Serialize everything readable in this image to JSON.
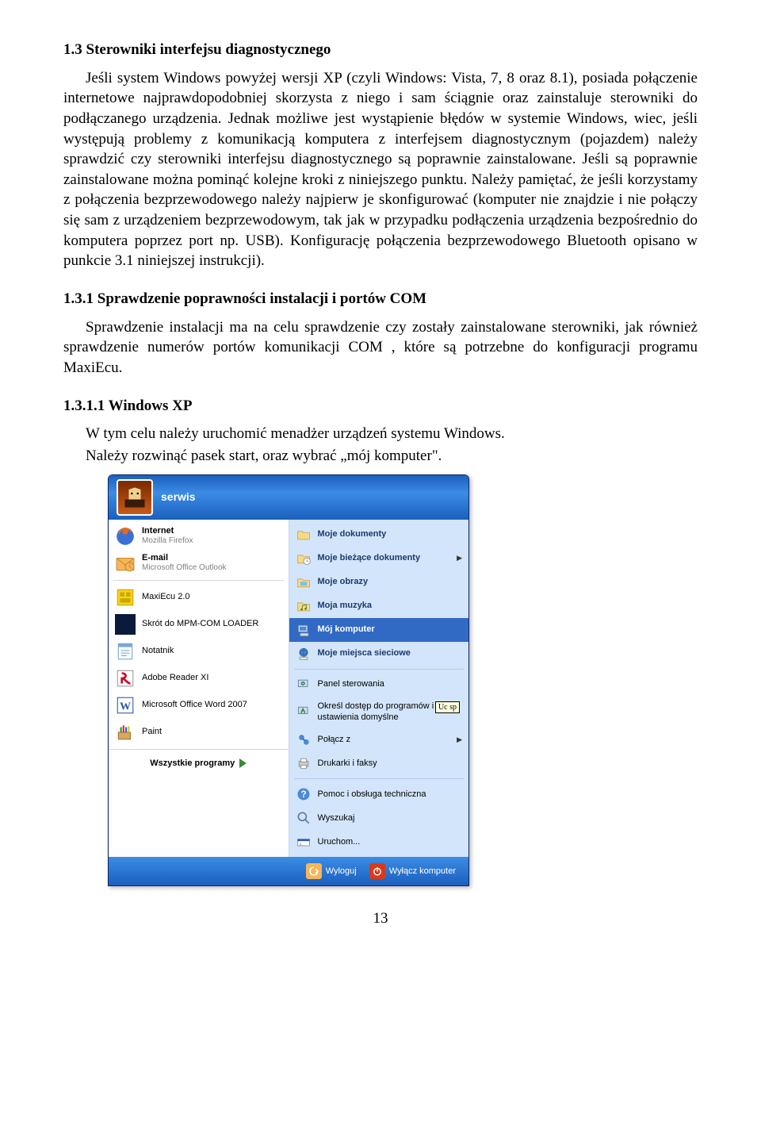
{
  "sec13": {
    "heading": "1.3 Sterowniki interfejsu diagnostycznego",
    "body": "Jeśli system Windows powyżej wersji XP (czyli Windows: Vista, 7, 8 oraz 8.1), posiada połączenie internetowe najprawdopodobniej skorzysta z niego i sam ściągnie oraz zainstaluje sterowniki do podłączanego urządzenia. Jednak możliwe jest wystąpienie błędów w systemie Windows, wiec, jeśli występują problemy z komunikacją komputera z interfejsem diagnostycznym (pojazdem) należy sprawdzić czy sterowniki interfejsu diagnostycznego są poprawnie zainstalowane. Jeśli są poprawnie zainstalowane można pominąć kolejne kroki z niniejszego punktu. Należy pamiętać, że jeśli korzystamy z połączenia bezprzewodowego należy najpierw je skonfigurować (komputer nie znajdzie i nie połączy się sam z urządzeniem bezprzewodowym, tak jak w przypadku podłączenia urządzenia bezpośrednio do komputera poprzez port np. USB). Konfigurację połączenia bezprzewodowego Bluetooth opisano w punkcie 3.1 niniejszej instrukcji)."
  },
  "sec131": {
    "heading": "1.3.1 Sprawdzenie poprawności instalacji i portów COM",
    "body": "Sprawdzenie instalacji ma na celu sprawdzenie czy zostały zainstalowane sterowniki, jak również sprawdzenie numerów portów komunikacji COM , które są potrzebne do konfiguracji programu MaxiEcu."
  },
  "sec1311": {
    "heading": "1.3.1.1 Windows XP",
    "line1": "W tym celu należy uruchomić menadżer urządzeń systemu Windows.",
    "line2": "Należy rozwinąć pasek start, oraz wybrać „mój komputer\"."
  },
  "start_menu": {
    "user": "serwis",
    "left": [
      {
        "label": "Internet",
        "sub": "Mozilla Firefox",
        "icon": "firefox"
      },
      {
        "label": "E-mail",
        "sub": "Microsoft Office Outlook",
        "icon": "outlook"
      },
      {
        "label": "MaxiEcu 2.0",
        "sub": "",
        "icon": "maxiecu"
      },
      {
        "label": "Skrót do MPM-COM LOADER",
        "sub": "",
        "icon": "moon"
      },
      {
        "label": "Notatnik",
        "sub": "",
        "icon": "notepad"
      },
      {
        "label": "Adobe Reader XI",
        "sub": "",
        "icon": "adobe"
      },
      {
        "label": "Microsoft Office Word 2007",
        "sub": "",
        "icon": "word"
      },
      {
        "label": "Paint",
        "sub": "",
        "icon": "paint"
      }
    ],
    "all_programs": "Wszystkie programy",
    "right": [
      {
        "label": "Moje dokumenty",
        "bold": true,
        "icon": "docs",
        "arrow": false
      },
      {
        "label": "Moje bieżące dokumenty",
        "bold": true,
        "icon": "recent",
        "arrow": true
      },
      {
        "label": "Moje obrazy",
        "bold": true,
        "icon": "pictures",
        "arrow": false
      },
      {
        "label": "Moja muzyka",
        "bold": true,
        "icon": "music",
        "arrow": false
      },
      {
        "label": "Mój komputer",
        "bold": true,
        "icon": "computer",
        "arrow": false,
        "selected": true
      },
      {
        "label": "Moje miejsca sieciowe",
        "bold": true,
        "icon": "network",
        "arrow": false
      },
      {
        "label": "Panel sterowania",
        "bold": false,
        "icon": "control",
        "arrow": false
      },
      {
        "label": "Określ dostęp do programów i ich ustawienia domyślne",
        "bold": false,
        "icon": "defaults",
        "arrow": false
      },
      {
        "label": "Połącz z",
        "bold": false,
        "icon": "connect",
        "arrow": true
      },
      {
        "label": "Drukarki i faksy",
        "bold": false,
        "icon": "printers",
        "arrow": false
      },
      {
        "label": "Pomoc i obsługa techniczna",
        "bold": false,
        "icon": "help",
        "arrow": false
      },
      {
        "label": "Wyszukaj",
        "bold": false,
        "icon": "search",
        "arrow": false
      },
      {
        "label": "Uruchom...",
        "bold": false,
        "icon": "run",
        "arrow": false
      }
    ],
    "right_separators_after": [
      5,
      9
    ],
    "footer": {
      "logoff": "Wyloguj",
      "shutdown": "Wyłącz komputer"
    },
    "tooltip": "Uc\nsp"
  },
  "page_number": "13"
}
